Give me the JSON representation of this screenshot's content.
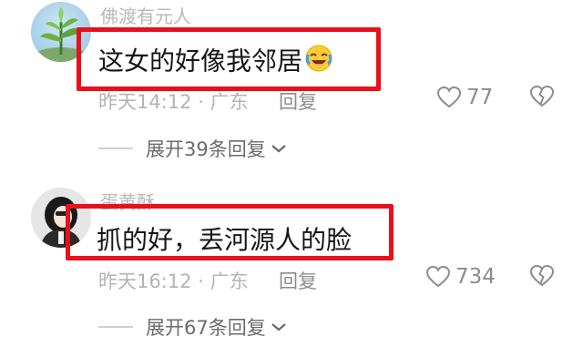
{
  "comments": [
    {
      "username": "佛渡有元人",
      "text": "这女的好像我邻居",
      "emoji": "laughing-crying-emoji",
      "time": "昨天14:12",
      "dot": "·",
      "location": "广东",
      "reply_label": "回复",
      "likes": "77",
      "expand_label": "展开39条回复"
    },
    {
      "username": "蛋黄酥",
      "text": "抓的好，丢河源人的脸",
      "time": "昨天16:12",
      "dot": "·",
      "location": "广东",
      "reply_label": "回复",
      "likes": "734",
      "expand_label": "展开67条回复"
    }
  ],
  "colors": {
    "highlight": "#e8101c",
    "text": "#161616",
    "meta": "#b4b4b4"
  }
}
